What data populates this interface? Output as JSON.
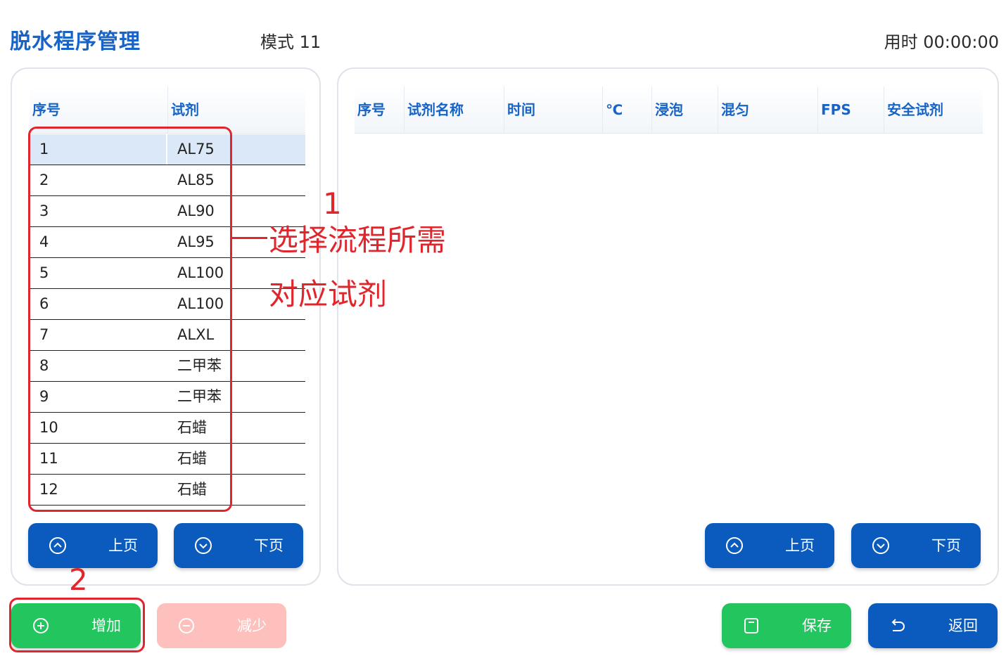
{
  "header": {
    "title": "脱水程序管理",
    "mode": "模式 11",
    "elapsed": "用时 00:00:00"
  },
  "reagent_table": {
    "columns": [
      "序号",
      "试剂"
    ],
    "rows": [
      [
        "1",
        "AL75"
      ],
      [
        "2",
        "AL85"
      ],
      [
        "3",
        "AL90"
      ],
      [
        "4",
        "AL95"
      ],
      [
        "5",
        "AL100"
      ],
      [
        "6",
        "AL100"
      ],
      [
        "7",
        "ALXL"
      ],
      [
        "8",
        "二甲苯"
      ],
      [
        "9",
        "二甲苯"
      ],
      [
        "10",
        "石蜡"
      ],
      [
        "11",
        "石蜡"
      ],
      [
        "12",
        "石蜡"
      ]
    ],
    "selected_row": 1
  },
  "program_table": {
    "columns": [
      "序号",
      "试剂名称",
      "时间",
      "℃",
      "浸泡",
      "混匀",
      "FPS",
      "安全试剂"
    ],
    "rows": []
  },
  "buttons": {
    "prev_page": "上页",
    "next_page": "下页",
    "add": "增加",
    "remove": "减少",
    "save": "保存",
    "back": "返回"
  },
  "annotations": {
    "step1_number": "1",
    "step1_line1": "选择流程所需",
    "step1_line2": "对应试剂",
    "step2_number": "2"
  },
  "colors": {
    "title_blue": "#1763c6",
    "button_blue": "#0a5bbd",
    "button_green": "#22c55e",
    "button_disabled": "#fdc0bc",
    "annotation_red": "#e0262d"
  }
}
